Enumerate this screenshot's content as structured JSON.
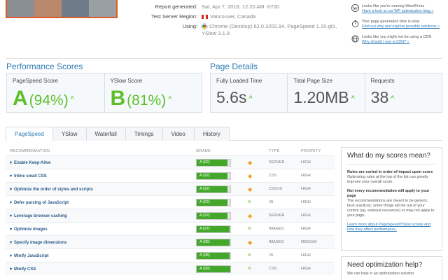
{
  "report": {
    "generated_label": "Report generated:",
    "generated_value": "Sat, Apr 7, 2018, 12:20 AM -0700",
    "region_label": "Test Server Region:",
    "region_value": "Vancouver, Canada",
    "using_label": "Using:",
    "using_value_1": "Chrome (Desktop) 62.0.3202.94, PageSpeed 1.15-gt1,",
    "using_value_2": "YSlow 3.1.8"
  },
  "tips": [
    {
      "icon": "wordpress-icon",
      "title": "Looks like you're running WordPress",
      "link": "Have a look at our WP optimization blog »"
    },
    {
      "icon": "stopwatch-icon",
      "title": "Your page generation time is slow",
      "link": "Find out why and explore possible solutions »"
    },
    {
      "icon": "globe-icon",
      "title": "Looks like you might not be using a CDN",
      "link": "Why should I use a CDN? »"
    }
  ],
  "performance": {
    "title": "Performance Scores",
    "pagespeed_label": "PageSpeed Score",
    "pagespeed_grade": "A",
    "pagespeed_pct": "(94%)",
    "yslow_label": "YSlow Score",
    "yslow_grade": "B",
    "yslow_pct": "(81%)"
  },
  "details": {
    "title": "Page Details",
    "load_label": "Fully Loaded Time",
    "load_value": "5.6s",
    "size_label": "Total Page Size",
    "size_value": "1.20MB",
    "requests_label": "Requests",
    "requests_value": "38"
  },
  "tabs": [
    "PageSpeed",
    "YSlow",
    "Waterfall",
    "Timings",
    "Video",
    "History"
  ],
  "table": {
    "headers": {
      "recommendation": "RECOMMENDATION",
      "grade": "GRADE",
      "type": "TYPE",
      "priority": "PRIORITY"
    },
    "rows": [
      {
        "name": "Enable Keep-Alive",
        "grade": "A (92)",
        "score": 0.92,
        "trend": "diamond",
        "type": "SERVER",
        "priority": "HIGH"
      },
      {
        "name": "Inline small CSS",
        "grade": "A (92)",
        "score": 0.92,
        "trend": "diamond",
        "type": "CSS",
        "priority": "HIGH"
      },
      {
        "name": "Optimize the order of styles and scripts",
        "grade": "A (92)",
        "score": 0.92,
        "trend": "diamond",
        "type": "CSS/JS",
        "priority": "HIGH"
      },
      {
        "name": "Defer parsing of JavaScript",
        "grade": "A (92)",
        "score": 0.92,
        "trend": "up",
        "type": "JS",
        "priority": "HIGH"
      },
      {
        "name": "Leverage browser caching",
        "grade": "A (92)",
        "score": 0.92,
        "trend": "diamond",
        "type": "SERVER",
        "priority": "HIGH"
      },
      {
        "name": "Optimize images",
        "grade": "A (97)",
        "score": 0.97,
        "trend": "up",
        "type": "IMAGES",
        "priority": "HIGH"
      },
      {
        "name": "Specify image dimensions",
        "grade": "A (98)",
        "score": 0.98,
        "trend": "diamond",
        "type": "IMAGES",
        "priority": "MEDIUM"
      },
      {
        "name": "Minify JavaScript",
        "grade": "A (98)",
        "score": 0.98,
        "trend": "up",
        "type": "JS",
        "priority": "HIGH"
      },
      {
        "name": "Minify CSS",
        "grade": "A (99)",
        "score": 0.99,
        "trend": "up",
        "type": "CSS",
        "priority": "HIGH"
      }
    ]
  },
  "scores_box": {
    "title": "What do my scores mean?",
    "p1_bold": "Rules are sorted in order of impact upon score",
    "p1_text": "Optimizing rules at the top of the list can greatly improve your overall score.",
    "p2_bold": "Not every recommendation will apply to your page",
    "p2_text": "The recommendations are meant to be generic, best practices; some things will be out of your control (eg. external resources) or may not apply to your page.",
    "link": "Learn more about PageSpeed/YSlow scores and how they affect performance."
  },
  "help_box": {
    "title": "Need optimization help?",
    "text": "We can help in an optimization solution"
  },
  "colors": {
    "accent": "#2a7ab6",
    "grade_green": "#5cbf2a",
    "bar_green": "#43a82a",
    "warn": "#f0a020"
  }
}
